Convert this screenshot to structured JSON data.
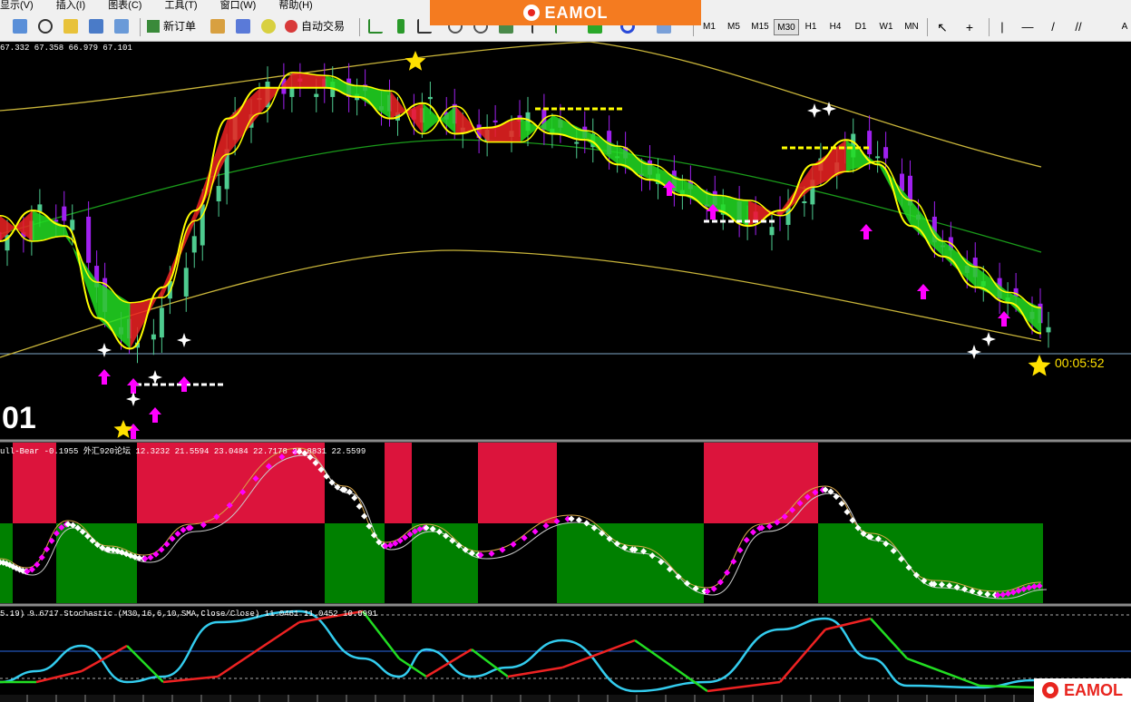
{
  "menu": [
    "显示(V)",
    "插入(I)",
    "图表(C)",
    "工具(T)",
    "窗口(W)",
    "帮助(H)"
  ],
  "toolbar": {
    "new_order": "新订单",
    "auto_trade": "自动交易",
    "timeframes": [
      "M1",
      "M5",
      "M15",
      "M30",
      "H1",
      "H4",
      "D1",
      "W1",
      "MN"
    ],
    "active_timeframe": "M30",
    "extra": "A"
  },
  "banner": {
    "brand": "EAMOL"
  },
  "corner": {
    "brand": "EAMOL"
  },
  "main_chart": {
    "ohlc": "67.332 67.358 66.979 67.101",
    "timer": "00:05:52",
    "big_label": "01"
  },
  "indicator1": {
    "label": "ull-Bear -0.1955  外汇920论坛  12.3232 21.5594 23.0484 22.7178 22.8831 22.5599"
  },
  "indicator2": {
    "label": "5.19) 9.6717  Stochastic (M30,16,6,10,SMA,Close/Close) 11.0461 11.0452 10.0991"
  },
  "colors": {
    "bull": "#22dd22",
    "bear": "#ee2222",
    "signal_line": "#ffff00",
    "band": "#c8b43a",
    "ma": "#1a9a1a",
    "up_arrow": "#ff00ff",
    "star": "#ffe000",
    "red_zone": "#dc143c",
    "green_zone": "#008000",
    "stoch_fast": "#33ccee",
    "stoch_slow": "#ee2222"
  },
  "chart_data": {
    "type": "line",
    "title": "",
    "series": [
      {
        "values": [
          67.45,
          67.55,
          67.5,
          67.2,
          67.1,
          67.3,
          67.55,
          67.85,
          67.95,
          67.95,
          67.95,
          67.92,
          67.85,
          67.9,
          67.8,
          67.82,
          67.85,
          67.8,
          67.78,
          67.7,
          67.65,
          67.6,
          67.55,
          67.5,
          67.55,
          67.7,
          67.78,
          67.7,
          67.5,
          67.4,
          67.3,
          67.25,
          67.15
        ]
      }
    ]
  }
}
